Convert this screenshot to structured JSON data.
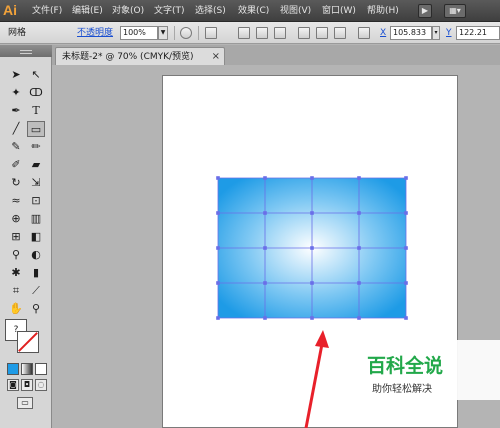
{
  "app": {
    "logo": "Ai",
    "menus": [
      "文件(F)",
      "编辑(E)",
      "对象(O)",
      "文字(T)",
      "选择(S)",
      "效果(C)",
      "视图(V)",
      "窗口(W)",
      "帮助(H)"
    ]
  },
  "control_bar": {
    "object_type": "网格",
    "opacity_label": "不透明度",
    "opacity_value": "100%",
    "x_label": "X",
    "x_value": "105.833",
    "y_label": "Y",
    "y_value": "122.21"
  },
  "document_tab": {
    "label": "未标题-2* @ 70% (CMYK/预览)",
    "close_glyph": "×"
  },
  "tools": {
    "fill_swatch_label": "?"
  },
  "mesh": {
    "edge_color": "#1e9be6",
    "center_color": "#ffffff",
    "grid_color": "#6a6ee8"
  },
  "watermark": {
    "title": "百科全说",
    "subtitle": "助你轻松解决",
    "color": "#22a84a"
  },
  "annotation": {
    "arrow_color": "#e8202a"
  }
}
